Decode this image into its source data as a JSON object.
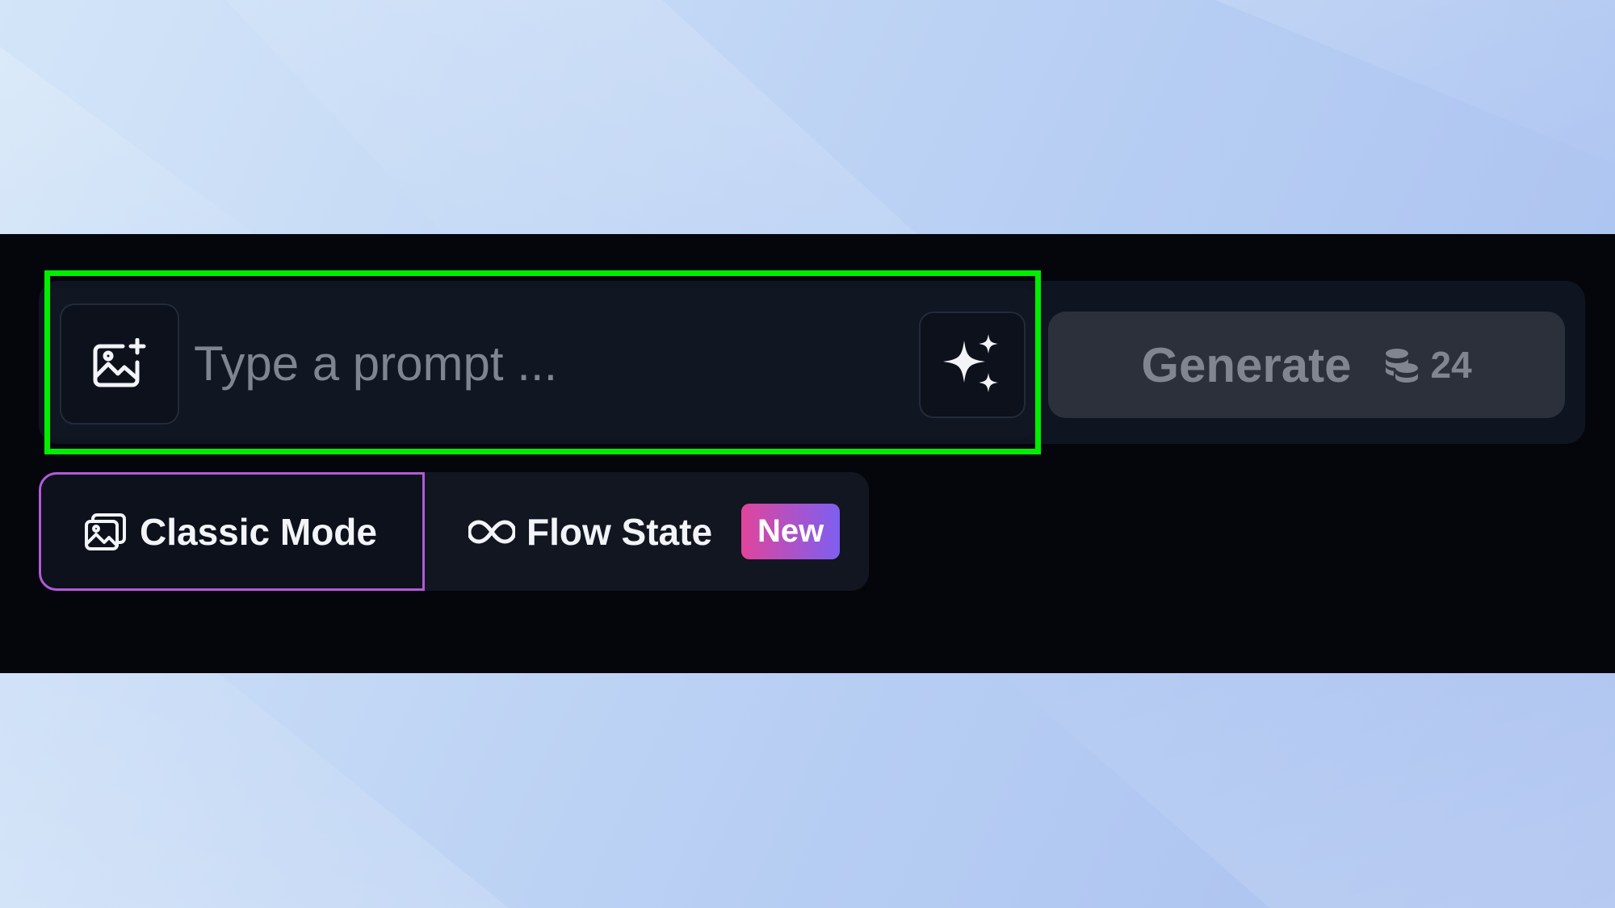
{
  "prompt": {
    "placeholder": "Type a prompt ...",
    "value": ""
  },
  "generate": {
    "label": "Generate",
    "credits": "24"
  },
  "modes": {
    "classic_label": "Classic Mode",
    "flow_label": "Flow State",
    "flow_badge": "New",
    "selected": "Classic Mode"
  },
  "icons": {
    "upload": "image-add-icon",
    "magic": "sparkles-icon",
    "credits": "coins-icon",
    "classic": "images-icon",
    "flow": "infinity-icon"
  },
  "colors": {
    "band_background": "#04060c",
    "highlight": "#00ee00",
    "selected_mode_border": "#b35ad8",
    "badge_gradient_start": "#e0459c",
    "badge_gradient_end": "#7d5ff0"
  }
}
